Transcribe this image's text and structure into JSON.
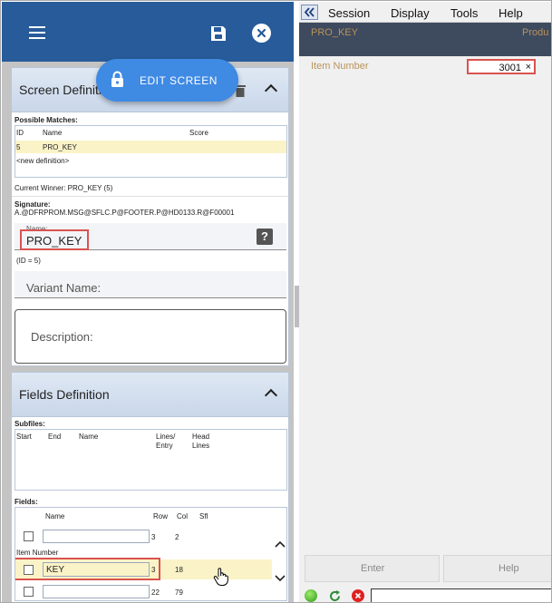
{
  "left": {
    "edit_button": "EDIT SCREEN",
    "screen_def": {
      "title": "Screen Definition",
      "possible_matches_label": "Possible Matches:",
      "columns": [
        "ID",
        "Name",
        "Score"
      ],
      "rows": [
        {
          "id": "5",
          "name": "PRO_KEY",
          "score": ""
        }
      ],
      "new_def": "<new definition>",
      "current_winner": "Current Winner: PRO_KEY (5)",
      "signature_label": "Signature:",
      "signature": "A.@DFRPROM.MSG@SFLC.P@FOOTER.P@HD0133.R@F00001",
      "name_label": "Name:",
      "name_value": "PRO_KEY",
      "help_glyph": "?",
      "id_note": "(ID = 5)",
      "variant_placeholder": "Variant Name:",
      "description_placeholder": "Description:"
    },
    "fields_def": {
      "title": "Fields Definition",
      "subfiles_label": "Subfiles:",
      "subfile_columns": [
        "Start",
        "End",
        "Name",
        "Lines/\nEntry",
        "Head\nLines"
      ],
      "fields_label": "Fields:",
      "field_columns": [
        "Name",
        "Row",
        "Col",
        "Sfl"
      ],
      "rows": [
        {
          "name": "",
          "row": "3",
          "col": "2",
          "caption": "Item Number"
        },
        {
          "name": "KEY",
          "row": "3",
          "col": "18",
          "caption": ""
        },
        {
          "name": "",
          "row": "22",
          "col": "79",
          "caption": ""
        }
      ]
    }
  },
  "right": {
    "menu": [
      "Session",
      "Display",
      "Tools",
      "Help"
    ],
    "header_left": "PRO_KEY",
    "header_right": "Produ",
    "item_label": "Item Number",
    "item_value": "3001",
    "clear_glyph": "×",
    "enter_label": "Enter",
    "help_label": "Help"
  },
  "colors": {
    "topbar": "#275b9a",
    "edit_button": "#3f8ae3",
    "highlight_row": "#fbf3c8",
    "red_outline": "#d9534f",
    "dark_band": "#3e4a5e",
    "field_label": "#b9935b"
  },
  "icons": [
    "menu-icon",
    "save-icon",
    "close-icon",
    "lock-icon",
    "trash-icon",
    "chevron-up-icon",
    "help-icon",
    "collapse-icon",
    "cursor-hand-icon",
    "status-green-icon",
    "refresh-icon",
    "stop-icon"
  ]
}
